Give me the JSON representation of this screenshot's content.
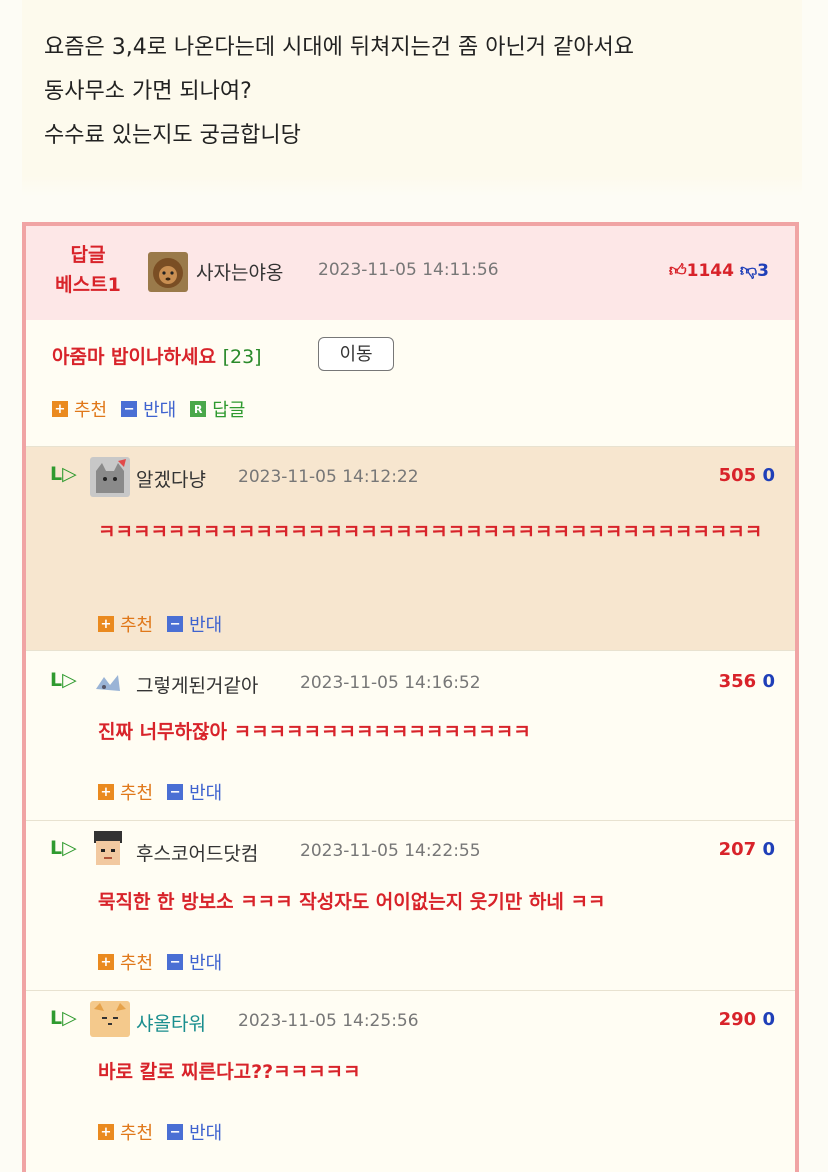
{
  "post": {
    "lines": [
      "요즘은 3,4로 나온다는데 시대에 뒤쳐지는건 좀 아닌거 같아서요",
      "동사무소 가면 되나여?",
      "수수료 있는지도 궁금합니당"
    ]
  },
  "best": {
    "tag_line1": "답글",
    "tag_line2": "베스트1",
    "nickname": "사자는야옹",
    "date": "2023-11-05 14:11:56",
    "up": "1144",
    "down": "3",
    "title": "아줌마 밥이나하세요",
    "count": "[23]",
    "move_label": "이동",
    "actions": {
      "up": "추천",
      "down": "반대",
      "reply": "답글"
    }
  },
  "replies": [
    {
      "nickname": "알겠다냥",
      "date": "2023-11-05 14:12:22",
      "up": "505",
      "down": "0",
      "content": "ㅋㅋㅋㅋㅋㅋㅋㅋㅋㅋㅋㅋㅋㅋㅋㅋㅋㅋㅋㅋㅋㅋㅋㅋㅋㅋㅋㅋㅋㅋㅋㅋㅋㅋㅋㅋㅋㅋ"
    },
    {
      "nickname": "그렇게된거같아",
      "date": "2023-11-05 14:16:52",
      "up": "356",
      "down": "0",
      "content": "진짜 너무하잖아 ㅋㅋㅋㅋㅋㅋㅋㅋㅋㅋㅋㅋㅋㅋㅋㅋㅋ"
    },
    {
      "nickname": "후스코어드닷컴",
      "date": "2023-11-05 14:22:55",
      "up": "207",
      "down": "0",
      "content": "묵직한 한 방보소 ㅋㅋㅋ 작성자도 어이없는지 웃기만 하네 ㅋㅋ"
    },
    {
      "nickname": "샤올타워",
      "date": "2023-11-05 14:25:56",
      "up": "290",
      "down": "0",
      "content": "바로 칼로 찌른다고??ㅋㅋㅋㅋㅋ"
    }
  ],
  "reply_actions": {
    "up": "추천",
    "down": "반대"
  },
  "reply_arrow": "L▷",
  "colors": {
    "accent_red": "#d8232a",
    "accent_blue": "#1f3fb8",
    "reply_green": "#2f9a2f",
    "box_border": "#f0a4a4",
    "highlight_bg": "#f7e6cf"
  }
}
